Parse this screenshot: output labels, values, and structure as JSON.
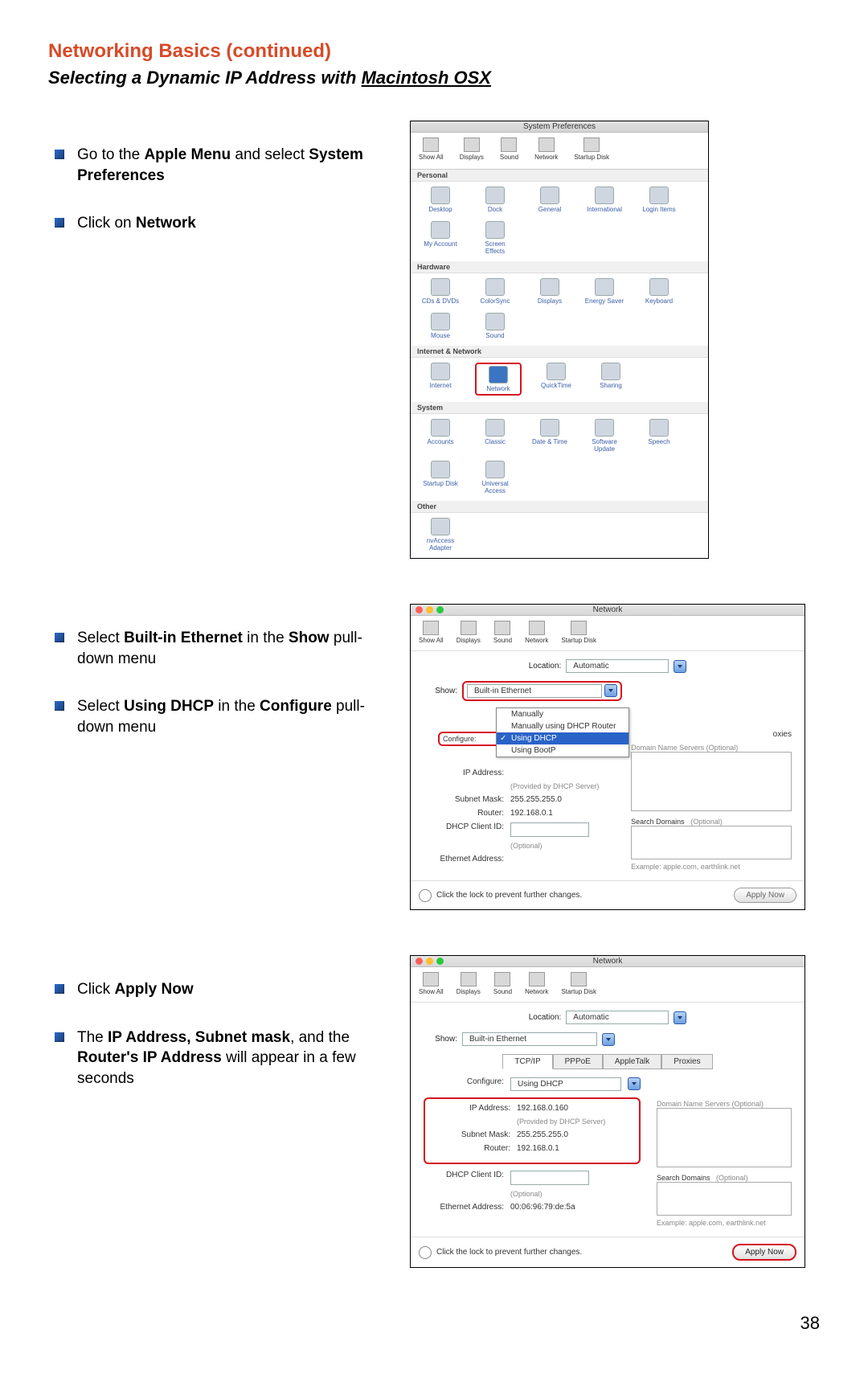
{
  "page": {
    "title": "Networking Basics (continued)",
    "subtitle_a": "Selecting a Dynamic IP Address with ",
    "subtitle_b": "Macintosh OSX",
    "page_number": "38"
  },
  "steps": {
    "s1": "Go to the <b>Apple Menu</b> and select <b>System Preferences</b>",
    "s2": "Click on <b>Network</b>",
    "s3": "Select <b>Built-in Ethernet</b> in the <b>Show</b> pull-down menu",
    "s4": "Select <b>Using DHCP</b> in the <b>Configure</b> pull-down menu",
    "s5": "Click <b>Apply Now</b>",
    "s6": "The <b>IP Address, Subnet mask</b>, and the <b>Router's IP Address</b> will appear in a few seconds"
  },
  "sysprefs": {
    "window_title": "System Preferences",
    "toolbar": [
      "Show All",
      "Displays",
      "Sound",
      "Network",
      "Startup Disk"
    ],
    "categories": {
      "Personal": [
        "Desktop",
        "Dock",
        "General",
        "International",
        "Login Items",
        "My Account",
        "Screen Effects"
      ],
      "Hardware": [
        "CDs & DVDs",
        "ColorSync",
        "Displays",
        "Energy Saver",
        "Keyboard",
        "Mouse",
        "Sound"
      ],
      "Internet & Network": [
        "Internet",
        "Network",
        "QuickTime",
        "Sharing"
      ],
      "System": [
        "Accounts",
        "Classic",
        "Date & Time",
        "Software Update",
        "Speech",
        "Startup Disk",
        "Universal Access"
      ],
      "Other": [
        "nvAccess Adapter"
      ]
    },
    "highlight": "Network"
  },
  "net1": {
    "window_title": "Network",
    "toolbar": [
      "Show All",
      "Displays",
      "Sound",
      "Network",
      "Startup Disk"
    ],
    "location_label": "Location:",
    "location_value": "Automatic",
    "show_label": "Show:",
    "show_value": "Built-in Ethernet",
    "configure_label": "Configure:",
    "dropdown": {
      "opt1": "Manually",
      "opt2": "Manually using DHCP Router",
      "opt3": "Using DHCP",
      "opt4": "Using BootP"
    },
    "proxies_tab": "oxies",
    "ip_label": "IP Address:",
    "ip_note": "(Provided by DHCP Server)",
    "subnet_label": "Subnet Mask:",
    "subnet_value": "255.255.255.0",
    "router_label": "Router:",
    "router_value": "192.168.0.1",
    "dhcpid_label": "DHCP Client ID:",
    "dhcpid_note": "(Optional)",
    "eth_label": "Ethernet Address:",
    "dns_label": "Domain Name Servers  (Optional)",
    "search_label": "Search Domains",
    "search_opt": "(Optional)",
    "example": "Example: apple.com, earthlink.net",
    "lock_text": "Click the lock to prevent further changes.",
    "apply": "Apply Now"
  },
  "net2": {
    "window_title": "Network",
    "toolbar": [
      "Show All",
      "Displays",
      "Sound",
      "Network",
      "Startup Disk"
    ],
    "location_label": "Location:",
    "location_value": "Automatic",
    "show_label": "Show:",
    "show_value": "Built-in Ethernet",
    "tabs": {
      "t1": "TCP/IP",
      "t2": "PPPoE",
      "t3": "AppleTalk",
      "t4": "Proxies"
    },
    "configure_label": "Configure:",
    "configure_value": "Using DHCP",
    "ip_label": "IP Address:",
    "ip_value": "192.168.0.160",
    "ip_note": "(Provided by DHCP Server)",
    "subnet_label": "Subnet Mask:",
    "subnet_value": "255.255.255.0",
    "router_label": "Router:",
    "router_value": "192.168.0.1",
    "dhcpid_label": "DHCP Client ID:",
    "dhcpid_note": "(Optional)",
    "eth_label": "Ethernet Address:",
    "eth_value": "00:06:96:79:de:5a",
    "dns_label": "Domain Name Servers  (Optional)",
    "search_label": "Search Domains",
    "search_opt": "(Optional)",
    "example": "Example: apple.com, earthlink.net",
    "lock_text": "Click the lock to prevent further changes.",
    "apply": "Apply Now"
  }
}
